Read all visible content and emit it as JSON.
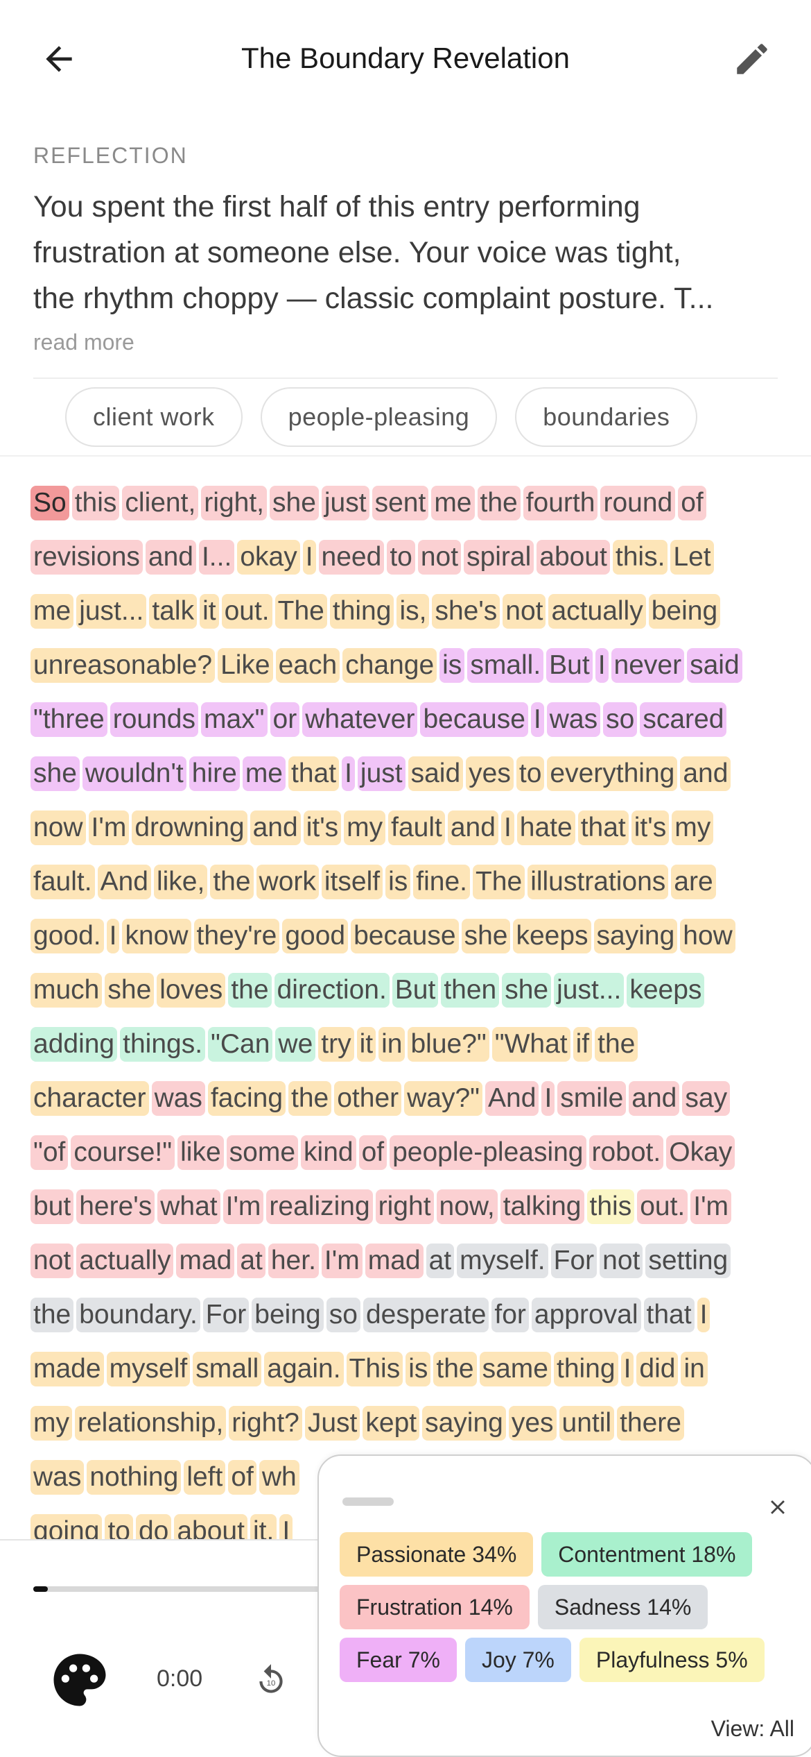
{
  "header": {
    "title": "The Boundary Revelation"
  },
  "reflection": {
    "label": "REFLECTION",
    "line1": "You spent the first half of this entry performing",
    "line2": "frustration at someone else. Your voice was tight,",
    "line3": "the rhythm choppy — classic complaint posture. T...",
    "read_more": "read more"
  },
  "tags": [
    "client work",
    "people-pleasing",
    "boundaries"
  ],
  "transcript_lines": [
    [
      [
        "So",
        "active"
      ],
      [
        "this",
        "frustration"
      ],
      [
        "client,",
        "frustration"
      ],
      [
        "right,",
        "frustration"
      ],
      [
        "she",
        "frustration"
      ],
      [
        "just",
        "frustration"
      ],
      [
        "sent",
        "frustration"
      ],
      [
        "me",
        "frustration"
      ],
      [
        "the",
        "frustration"
      ],
      [
        "fourth",
        "frustration"
      ],
      [
        "round",
        "frustration"
      ],
      [
        "of",
        "frustration"
      ]
    ],
    [
      [
        "revisions",
        "frustration"
      ],
      [
        "and",
        "frustration"
      ],
      [
        "I...",
        "frustration"
      ],
      [
        "okay",
        "passionate"
      ],
      [
        "I",
        "passionate"
      ],
      [
        "need",
        "frustration"
      ],
      [
        "to",
        "frustration"
      ],
      [
        "not",
        "frustration"
      ],
      [
        "spiral",
        "frustration"
      ],
      [
        "about",
        "frustration"
      ],
      [
        "this.",
        "passionate"
      ],
      [
        "Let",
        "passionate"
      ]
    ],
    [
      [
        "me",
        "passionate"
      ],
      [
        "just...",
        "passionate"
      ],
      [
        "talk",
        "passionate"
      ],
      [
        "it",
        "passionate"
      ],
      [
        "out.",
        "passionate"
      ],
      [
        "The",
        "passionate"
      ],
      [
        "thing",
        "passionate"
      ],
      [
        "is,",
        "passionate"
      ],
      [
        "she's",
        "passionate"
      ],
      [
        "not",
        "passionate"
      ],
      [
        "actually",
        "passionate"
      ],
      [
        "being",
        "passionate"
      ]
    ],
    [
      [
        "unreasonable?",
        "passionate"
      ],
      [
        "Like",
        "passionate"
      ],
      [
        "each",
        "passionate"
      ],
      [
        "change",
        "passionate"
      ],
      [
        "is",
        "fear"
      ],
      [
        "small.",
        "fear"
      ],
      [
        "But",
        "fear"
      ],
      [
        "I",
        "fear"
      ],
      [
        "never",
        "fear"
      ],
      [
        "said",
        "fear"
      ]
    ],
    [
      [
        "\"three",
        "fear"
      ],
      [
        "rounds",
        "fear"
      ],
      [
        "max\"",
        "fear"
      ],
      [
        "or",
        "fear"
      ],
      [
        "whatever",
        "fear"
      ],
      [
        "because",
        "fear"
      ],
      [
        "I",
        "fear"
      ],
      [
        "was",
        "fear"
      ],
      [
        "so",
        "fear"
      ],
      [
        "scared",
        "fear"
      ]
    ],
    [
      [
        "she",
        "fear"
      ],
      [
        "wouldn't",
        "fear"
      ],
      [
        "hire",
        "fear"
      ],
      [
        "me",
        "fear"
      ],
      [
        "that",
        "passionate"
      ],
      [
        "I",
        "fear"
      ],
      [
        "just",
        "fear"
      ],
      [
        "said",
        "passionate"
      ],
      [
        "yes",
        "passionate"
      ],
      [
        "to",
        "passionate"
      ],
      [
        "everything",
        "passionate"
      ],
      [
        "and",
        "passionate"
      ]
    ],
    [
      [
        "now",
        "passionate"
      ],
      [
        "I'm",
        "passionate"
      ],
      [
        "drowning",
        "passionate"
      ],
      [
        "and",
        "passionate"
      ],
      [
        "it's",
        "passionate"
      ],
      [
        "my",
        "passionate"
      ],
      [
        "fault",
        "passionate"
      ],
      [
        "and",
        "passionate"
      ],
      [
        "I",
        "passionate"
      ],
      [
        "hate",
        "passionate"
      ],
      [
        "that",
        "passionate"
      ],
      [
        "it's",
        "passionate"
      ],
      [
        "my",
        "passionate"
      ]
    ],
    [
      [
        "fault.",
        "passionate"
      ],
      [
        "And",
        "passionate"
      ],
      [
        "like,",
        "passionate"
      ],
      [
        "the",
        "passionate"
      ],
      [
        "work",
        "passionate"
      ],
      [
        "itself",
        "passionate"
      ],
      [
        "is",
        "passionate"
      ],
      [
        "fine.",
        "passionate"
      ],
      [
        "The",
        "passionate"
      ],
      [
        "illustrations",
        "passionate"
      ],
      [
        "are",
        "passionate"
      ]
    ],
    [
      [
        "good.",
        "passionate"
      ],
      [
        "I",
        "passionate"
      ],
      [
        "know",
        "passionate"
      ],
      [
        "they're",
        "passionate"
      ],
      [
        "good",
        "passionate"
      ],
      [
        "because",
        "passionate"
      ],
      [
        "she",
        "passionate"
      ],
      [
        "keeps",
        "passionate"
      ],
      [
        "saying",
        "passionate"
      ],
      [
        "how",
        "passionate"
      ]
    ],
    [
      [
        "much",
        "passionate"
      ],
      [
        "she",
        "passionate"
      ],
      [
        "loves",
        "passionate"
      ],
      [
        "the",
        "contentment"
      ],
      [
        "direction.",
        "contentment"
      ],
      [
        "But",
        "contentment"
      ],
      [
        "then",
        "contentment"
      ],
      [
        "she",
        "contentment"
      ],
      [
        "just...",
        "contentment"
      ],
      [
        "keeps",
        "contentment"
      ]
    ],
    [
      [
        "adding",
        "contentment"
      ],
      [
        "things.",
        "contentment"
      ],
      [
        "\"Can",
        "contentment"
      ],
      [
        "we",
        "contentment"
      ],
      [
        "try",
        "passionate"
      ],
      [
        "it",
        "passionate"
      ],
      [
        "in",
        "passionate"
      ],
      [
        "blue?\"",
        "passionate"
      ],
      [
        "\"What",
        "passionate"
      ],
      [
        "if",
        "passionate"
      ],
      [
        "the",
        "passionate"
      ]
    ],
    [
      [
        "character",
        "passionate"
      ],
      [
        "was",
        "frustration"
      ],
      [
        "facing",
        "passionate"
      ],
      [
        "the",
        "passionate"
      ],
      [
        "other",
        "passionate"
      ],
      [
        "way?\"",
        "passionate"
      ],
      [
        "And",
        "frustration"
      ],
      [
        "I",
        "frustration"
      ],
      [
        "smile",
        "frustration"
      ],
      [
        "and",
        "frustration"
      ],
      [
        "say",
        "frustration"
      ]
    ],
    [
      [
        "\"of",
        "frustration"
      ],
      [
        "course!\"",
        "frustration"
      ],
      [
        "like",
        "frustration"
      ],
      [
        "some",
        "frustration"
      ],
      [
        "kind",
        "frustration"
      ],
      [
        "of",
        "frustration"
      ],
      [
        "people-pleasing",
        "frustration"
      ],
      [
        "robot.",
        "frustration"
      ],
      [
        "Okay",
        "frustration"
      ]
    ],
    [
      [
        "but",
        "frustration"
      ],
      [
        "here's",
        "frustration"
      ],
      [
        "what",
        "frustration"
      ],
      [
        "I'm",
        "frustration"
      ],
      [
        "realizing",
        "frustration"
      ],
      [
        "right",
        "frustration"
      ],
      [
        "now,",
        "frustration"
      ],
      [
        "talking",
        "frustration"
      ],
      [
        "this",
        "playfulness"
      ],
      [
        "out.",
        "frustration"
      ],
      [
        "I'm",
        "frustration"
      ]
    ],
    [
      [
        "not",
        "frustration"
      ],
      [
        "actually",
        "frustration"
      ],
      [
        "mad",
        "frustration"
      ],
      [
        "at",
        "frustration"
      ],
      [
        "her.",
        "frustration"
      ],
      [
        "I'm",
        "frustration"
      ],
      [
        "mad",
        "frustration"
      ],
      [
        "at",
        "sadness"
      ],
      [
        "myself.",
        "sadness"
      ],
      [
        "For",
        "sadness"
      ],
      [
        "not",
        "sadness"
      ],
      [
        "setting",
        "sadness"
      ]
    ],
    [
      [
        "the",
        "sadness"
      ],
      [
        "boundary.",
        "sadness"
      ],
      [
        "For",
        "sadness"
      ],
      [
        "being",
        "sadness"
      ],
      [
        "so",
        "sadness"
      ],
      [
        "desperate",
        "sadness"
      ],
      [
        "for",
        "sadness"
      ],
      [
        "approval",
        "sadness"
      ],
      [
        "that",
        "sadness"
      ],
      [
        "I",
        "passionate"
      ]
    ],
    [
      [
        "made",
        "passionate"
      ],
      [
        "myself",
        "passionate"
      ],
      [
        "small",
        "passionate"
      ],
      [
        "again.",
        "passionate"
      ],
      [
        "This",
        "passionate"
      ],
      [
        "is",
        "passionate"
      ],
      [
        "the",
        "passionate"
      ],
      [
        "same",
        "passionate"
      ],
      [
        "thing",
        "passionate"
      ],
      [
        "I",
        "passionate"
      ],
      [
        "did",
        "passionate"
      ],
      [
        "in",
        "passionate"
      ]
    ],
    [
      [
        "my",
        "passionate"
      ],
      [
        "relationship,",
        "passionate"
      ],
      [
        "right?",
        "passionate"
      ],
      [
        "Just",
        "passionate"
      ],
      [
        "kept",
        "passionate"
      ],
      [
        "saying",
        "passionate"
      ],
      [
        "yes",
        "passionate"
      ],
      [
        "until",
        "passionate"
      ],
      [
        "there",
        "passionate"
      ]
    ],
    [
      [
        "was",
        "passionate"
      ],
      [
        "nothing",
        "passionate"
      ],
      [
        "left",
        "passionate"
      ],
      [
        "of",
        "passionate"
      ],
      [
        "wh",
        "passionate"
      ]
    ],
    [
      [
        "going",
        "passionate"
      ],
      [
        "to",
        "passionate"
      ],
      [
        "do",
        "passionate"
      ],
      [
        "about",
        "passionate"
      ],
      [
        "it.",
        "passionate"
      ],
      [
        "I",
        "passionate"
      ]
    ]
  ],
  "player": {
    "time": "0:00",
    "progress": 0.02,
    "rewind_label": "10"
  },
  "emotion_popup": {
    "rows": [
      [
        {
          "label": "Passionate 34%",
          "color": "#fde0a6"
        },
        {
          "label": "Contentment 18%",
          "color": "#a9f0cd"
        }
      ],
      [
        {
          "label": "Frustration 14%",
          "color": "#fbc3c5"
        },
        {
          "label": "Sadness 14%",
          "color": "#dcdfe3"
        }
      ],
      [
        {
          "label": "Fear 7%",
          "color": "#efb0f7"
        },
        {
          "label": "Joy 7%",
          "color": "#bcd5fb"
        },
        {
          "label": "Playfulness 5%",
          "color": "#fbf5b8"
        }
      ]
    ],
    "view_label": "View: All"
  }
}
